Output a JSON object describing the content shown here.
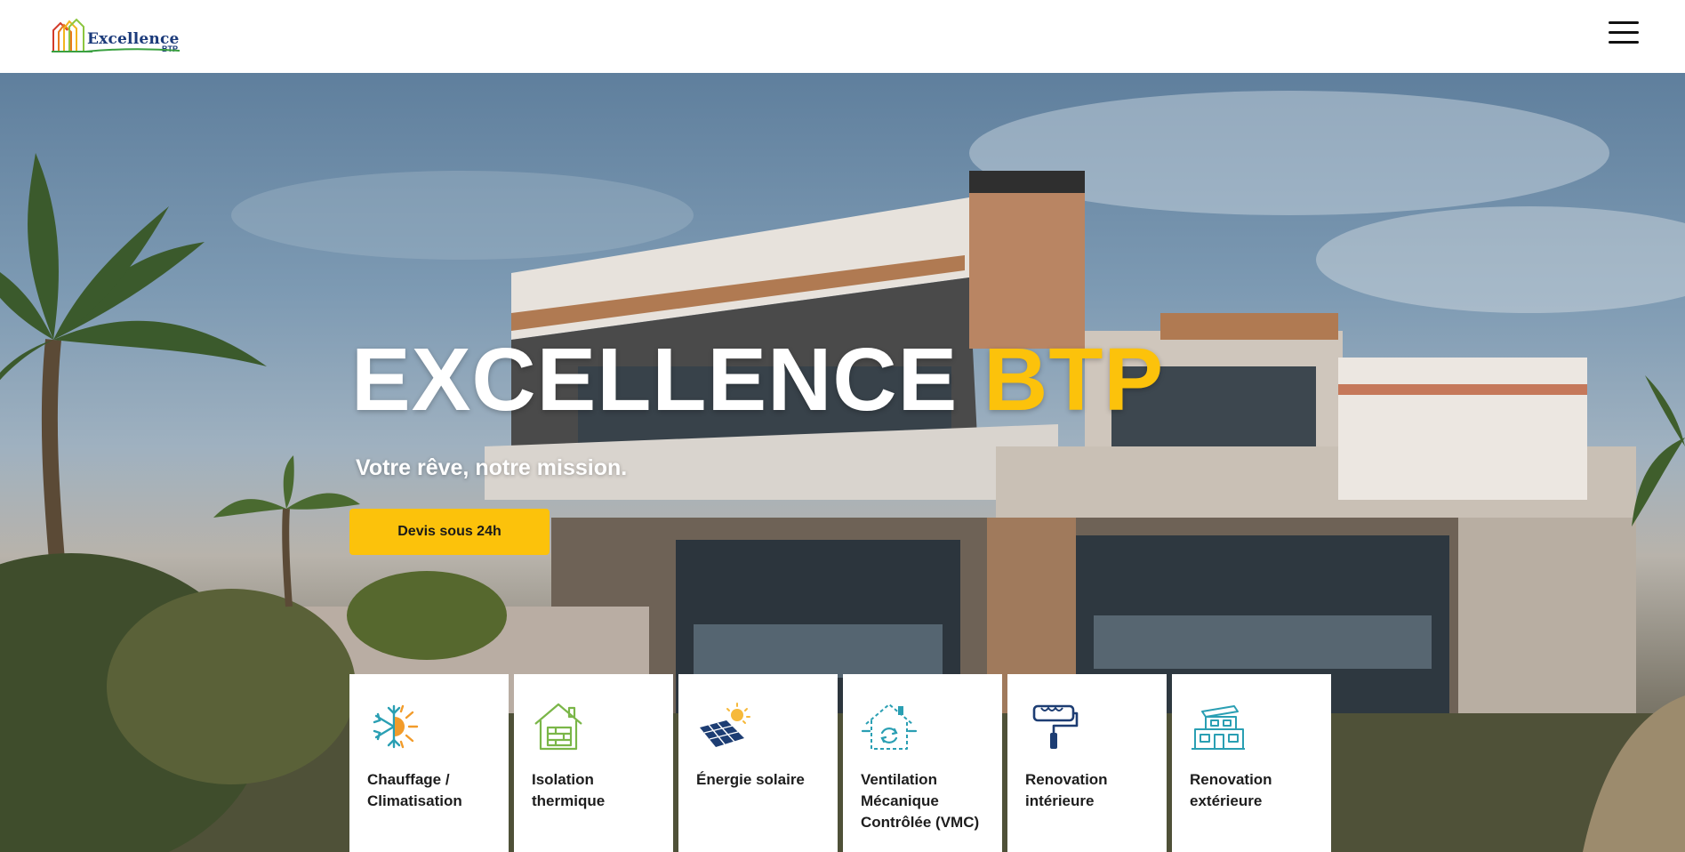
{
  "header": {
    "logo_text": "Excellence",
    "logo_sub": "BTP",
    "menu_icon": "hamburger-menu-icon"
  },
  "hero": {
    "title_main": "EXCELLENCE",
    "title_accent": "BTP",
    "subtitle": "Votre rêve, notre mission.",
    "cta_label": "Devis sous 24h"
  },
  "services": [
    {
      "label": "Chauffage / Climatisation",
      "icon": "snowflake-sun-icon"
    },
    {
      "label": "Isolation thermique",
      "icon": "house-insulation-icon"
    },
    {
      "label": "Énergie solaire",
      "icon": "solar-panel-icon"
    },
    {
      "label": "Ventilation Mécanique Contrôlée (VMC)",
      "icon": "house-ventilation-icon"
    },
    {
      "label": "Renovation intérieure",
      "icon": "paint-roller-icon"
    },
    {
      "label": "Renovation extérieure",
      "icon": "building-facade-icon"
    }
  ],
  "colors": {
    "accent": "#fcc20b",
    "text_dark": "#1d1d1d",
    "icon_teal": "#2a9fb3",
    "icon_orange": "#f29b2a",
    "icon_green": "#7ab648",
    "icon_navy": "#1d3d73"
  }
}
